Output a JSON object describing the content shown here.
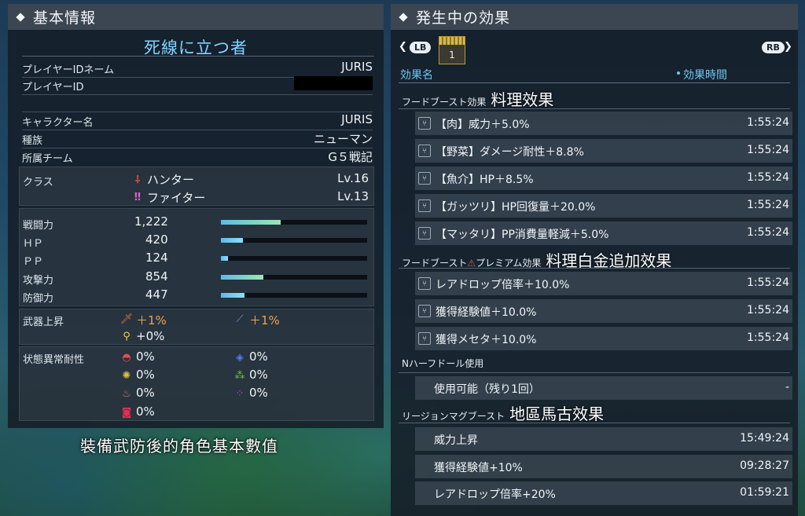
{
  "left": {
    "header": "基本情報",
    "title": "死線に立つ者",
    "player_id_name_label": "プレイヤーIDネーム",
    "player_id_name": "JURIS",
    "player_id_label": "プレイヤーID",
    "character_name_label": "キャラクター名",
    "character_name": "JURIS",
    "race_label": "種族",
    "race": "ニューマン",
    "team_label": "所属チーム",
    "team": "G５戦記",
    "class_label": "クラス",
    "main_class": "ハンター",
    "main_level": "Lv.16",
    "sub_class": "ファイター",
    "sub_level": "Lv.13",
    "stats": [
      {
        "label": "戦闘力",
        "value": "1,222",
        "fill": 0.41
      },
      {
        "label": "ＨＰ",
        "value": "420",
        "fill": 0.15
      },
      {
        "label": "ＰＰ",
        "value": "124",
        "fill": 0.05
      },
      {
        "label": "攻撃力",
        "value": "854",
        "fill": 0.29
      },
      {
        "label": "防御力",
        "value": "447",
        "fill": 0.16
      }
    ],
    "weapon_up_label": "武器上昇",
    "weapon_up": [
      "＋1%",
      "＋1%",
      "+0%"
    ],
    "resist_label": "状態異常耐性",
    "resist_values": [
      "0%",
      "0%",
      "0%",
      "0%",
      "0%",
      "0%",
      "0%"
    ],
    "caption": "裝備武防後的角色基本數值"
  },
  "right": {
    "header": "発生中の効果",
    "lb": "LB",
    "rb": "RB",
    "tab_count": "1",
    "col_name": "効果名",
    "col_time": "効果時間",
    "sections": [
      {
        "label": "フードブースト効果",
        "note": "料理效果",
        "items": [
          {
            "name": "【肉】威力＋5.0%",
            "time": "1:55:24"
          },
          {
            "name": "【野菜】ダメージ耐性＋8.8%",
            "time": "1:55:24"
          },
          {
            "name": "【魚介】HP＋8.5%",
            "time": "1:55:24"
          },
          {
            "name": "【ガッツリ】HP回復量＋20.0%",
            "time": "1:55:24"
          },
          {
            "name": "【マッタリ】PP消費量軽減＋5.0%",
            "time": "1:55:24"
          }
        ]
      },
      {
        "label": "フードブースト",
        "label2": "プレミアム効果",
        "note": "料理白金追加效果",
        "items": [
          {
            "name": "レアドロップ倍率＋10.0%",
            "time": "1:55:24"
          },
          {
            "name": "獲得経験値＋10.0%",
            "time": "1:55:24"
          },
          {
            "name": "獲得メセタ＋10.0%",
            "time": "1:55:24"
          }
        ]
      },
      {
        "label": "Nハーフドール使用",
        "note": "",
        "items": [
          {
            "name": "使用可能（残り1回）",
            "time": "-"
          }
        ]
      },
      {
        "label": "リージョンマグブースト",
        "note": "地區馬古效果",
        "items": [
          {
            "name": "威力上昇",
            "time": "15:49:24"
          },
          {
            "name": "獲得経験値+10%",
            "time": "09:28:27"
          },
          {
            "name": "レアドロップ倍率+20%",
            "time": "01:59:21"
          }
        ]
      }
    ]
  },
  "colors": {
    "accent": "#7fd4ff",
    "header_bg": "#3b4651",
    "panel_bg": "#161e28"
  }
}
